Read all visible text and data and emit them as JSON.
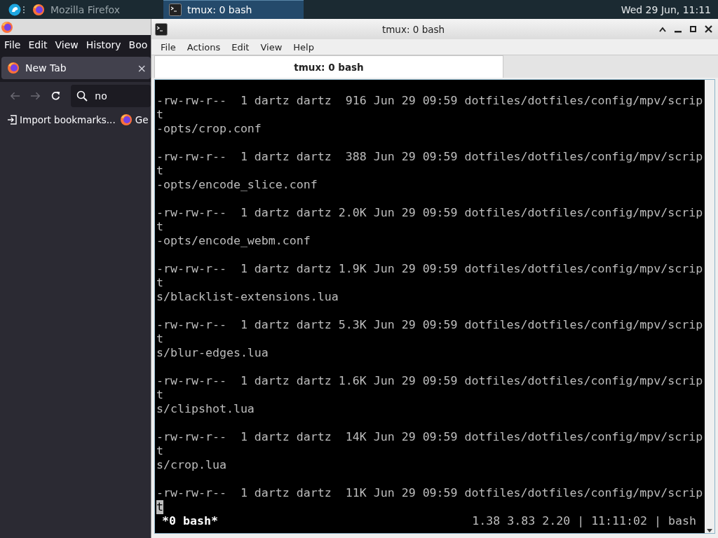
{
  "taskbar": {
    "items": [
      {
        "label": "Mozilla Firefox",
        "selected": false,
        "kind": "firefox"
      },
      {
        "label": "tmux: 0 bash",
        "selected": true,
        "kind": "terminal"
      }
    ],
    "clock": "Wed 29 Jun, 11:11"
  },
  "firefox": {
    "menu": [
      "File",
      "Edit",
      "View",
      "History",
      "Boo"
    ],
    "tab": {
      "label": "New Tab",
      "close": "×"
    },
    "address": {
      "value": "no"
    },
    "bookmarks": [
      "Import bookmarks...",
      "Ge"
    ]
  },
  "terminal": {
    "title": "tmux: 0 bash",
    "menu": [
      "File",
      "Actions",
      "Edit",
      "View",
      "Help"
    ],
    "tabs": [
      {
        "label": "tmux: 0 bash",
        "selected": true
      }
    ],
    "entries": [
      {
        "listing": "-rw-rw-r--  1 dartz dartz  916 Jun 29 09:59 dotfiles/dotfiles/config/mpv/scrip",
        "continuation": "t",
        "path": "-opts/crop.conf",
        "cursor": false
      },
      {
        "listing": "-rw-rw-r--  1 dartz dartz  388 Jun 29 09:59 dotfiles/dotfiles/config/mpv/scrip",
        "continuation": "t",
        "path": "-opts/encode_slice.conf",
        "cursor": false
      },
      {
        "listing": "-rw-rw-r--  1 dartz dartz 2.0K Jun 29 09:59 dotfiles/dotfiles/config/mpv/scrip",
        "continuation": "t",
        "path": "-opts/encode_webm.conf",
        "cursor": false
      },
      {
        "listing": "-rw-rw-r--  1 dartz dartz 1.9K Jun 29 09:59 dotfiles/dotfiles/config/mpv/scrip",
        "continuation": "t",
        "path": "s/blacklist-extensions.lua",
        "cursor": false
      },
      {
        "listing": "-rw-rw-r--  1 dartz dartz 5.3K Jun 29 09:59 dotfiles/dotfiles/config/mpv/scrip",
        "continuation": "t",
        "path": "s/blur-edges.lua",
        "cursor": false
      },
      {
        "listing": "-rw-rw-r--  1 dartz dartz 1.6K Jun 29 09:59 dotfiles/dotfiles/config/mpv/scrip",
        "continuation": "t",
        "path": "s/clipshot.lua",
        "cursor": false
      },
      {
        "listing": "-rw-rw-r--  1 dartz dartz  14K Jun 29 09:59 dotfiles/dotfiles/config/mpv/scrip",
        "continuation": "t",
        "path": "s/crop.lua",
        "cursor": false
      },
      {
        "listing": "-rw-rw-r--  1 dartz dartz  11K Jun 29 09:59 dotfiles/dotfiles/config/mpv/scrip",
        "continuation": "t",
        "cursor": true
      }
    ],
    "status": {
      "window": "*0 bash*",
      "info": "1.38 3.83 2.20 | 11:11:02 | bash"
    }
  }
}
